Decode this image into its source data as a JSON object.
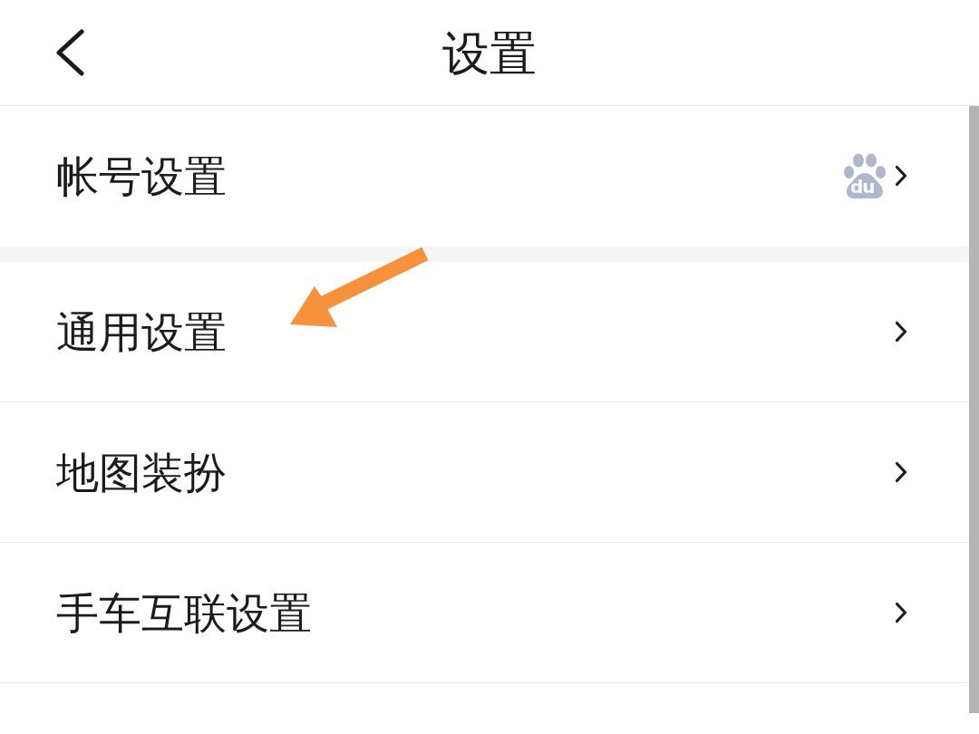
{
  "header": {
    "title": "设置"
  },
  "groups": [
    {
      "items": [
        {
          "label": "帐号设置",
          "logo_text": "du",
          "arrow_marked": false
        }
      ]
    },
    {
      "items": [
        {
          "label": "通用设置",
          "arrow_marked": true
        },
        {
          "label": "地图装扮",
          "arrow_marked": false
        },
        {
          "label": "手车互联设置",
          "arrow_marked": false
        }
      ]
    }
  ]
}
